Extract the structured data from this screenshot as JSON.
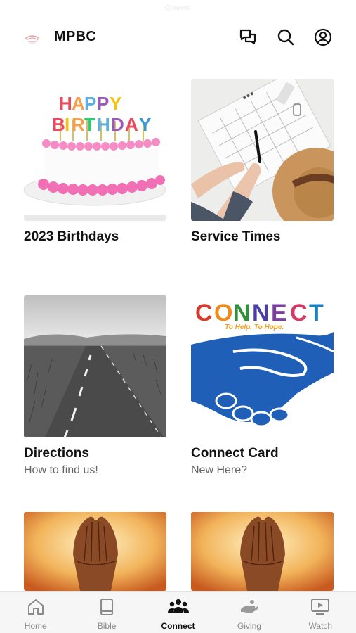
{
  "status_hint": "Connect",
  "header": {
    "title": "MPBC",
    "icons": [
      "chat-icon",
      "search-icon",
      "profile-icon"
    ]
  },
  "cards": [
    {
      "title": "2023 Birthdays",
      "subtitle": "",
      "image": "birthday-cake-image"
    },
    {
      "title": "Service Times",
      "subtitle": "",
      "image": "planner-writing-image"
    },
    {
      "title": "Directions",
      "subtitle": "How to find us!",
      "image": "road-image"
    },
    {
      "title": "Connect Card",
      "subtitle": "New Here?",
      "image": "connect-handshake-image"
    },
    {
      "title": "",
      "subtitle": "",
      "image": "praying-hands-image"
    },
    {
      "title": "",
      "subtitle": "",
      "image": "praying-hands-image"
    }
  ],
  "images": {
    "cake_text": "HAPPY BIRTHDAY",
    "connect_word": "CONNECT",
    "connect_tagline": "To Help. To Hope."
  },
  "colors": {
    "connect_letters": [
      "#d6382a",
      "#f08a1c",
      "#2f8f3a",
      "#4a3fa5",
      "#7a3fa1",
      "#d63a63",
      "#1e7fc2"
    ],
    "handshake_blue": "#1f5fb8"
  },
  "tabbar": {
    "active": "Connect",
    "tabs": [
      {
        "label": "Home",
        "icon": "home-icon"
      },
      {
        "label": "Bible",
        "icon": "bible-icon"
      },
      {
        "label": "Connect",
        "icon": "connect-icon"
      },
      {
        "label": "Giving",
        "icon": "giving-icon"
      },
      {
        "label": "Watch",
        "icon": "watch-icon"
      }
    ]
  }
}
